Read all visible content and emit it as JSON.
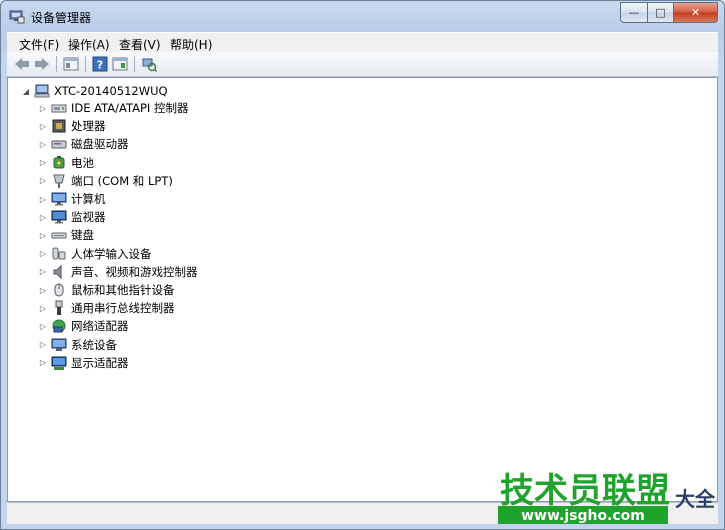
{
  "window": {
    "title": "设备管理器"
  },
  "caption": {
    "minimize": "—",
    "maximize": "□",
    "close": "✕"
  },
  "menu": [
    "文件(F)",
    "操作(A)",
    "查看(V)",
    "帮助(H)"
  ],
  "toolbar": {
    "items": [
      "back-icon",
      "forward-icon",
      "properties-view-icon",
      "help-icon",
      "details-icon",
      "scan-hardware-icon"
    ]
  },
  "tree": {
    "root": "XTC-20140512WUQ",
    "items": [
      {
        "label": "IDE ATA/ATAPI 控制器",
        "icon": "ide-controller-icon"
      },
      {
        "label": "处理器",
        "icon": "processor-icon"
      },
      {
        "label": "磁盘驱动器",
        "icon": "disk-drive-icon"
      },
      {
        "label": "电池",
        "icon": "battery-icon"
      },
      {
        "label": "端口 (COM 和 LPT)",
        "icon": "port-icon"
      },
      {
        "label": "计算机",
        "icon": "computer-icon"
      },
      {
        "label": "监视器",
        "icon": "monitor-icon"
      },
      {
        "label": "键盘",
        "icon": "keyboard-icon"
      },
      {
        "label": "人体学输入设备",
        "icon": "hid-icon"
      },
      {
        "label": "声音、视频和游戏控制器",
        "icon": "sound-icon"
      },
      {
        "label": "鼠标和其他指针设备",
        "icon": "mouse-icon"
      },
      {
        "label": "通用串行总线控制器",
        "icon": "usb-icon"
      },
      {
        "label": "网络适配器",
        "icon": "network-adapter-icon"
      },
      {
        "label": "系统设备",
        "icon": "system-device-icon"
      },
      {
        "label": "显示适配器",
        "icon": "display-adapter-icon"
      }
    ]
  },
  "watermark": {
    "text": "技术员联盟",
    "url": "www.jsgho.com",
    "suffix": "大全"
  }
}
